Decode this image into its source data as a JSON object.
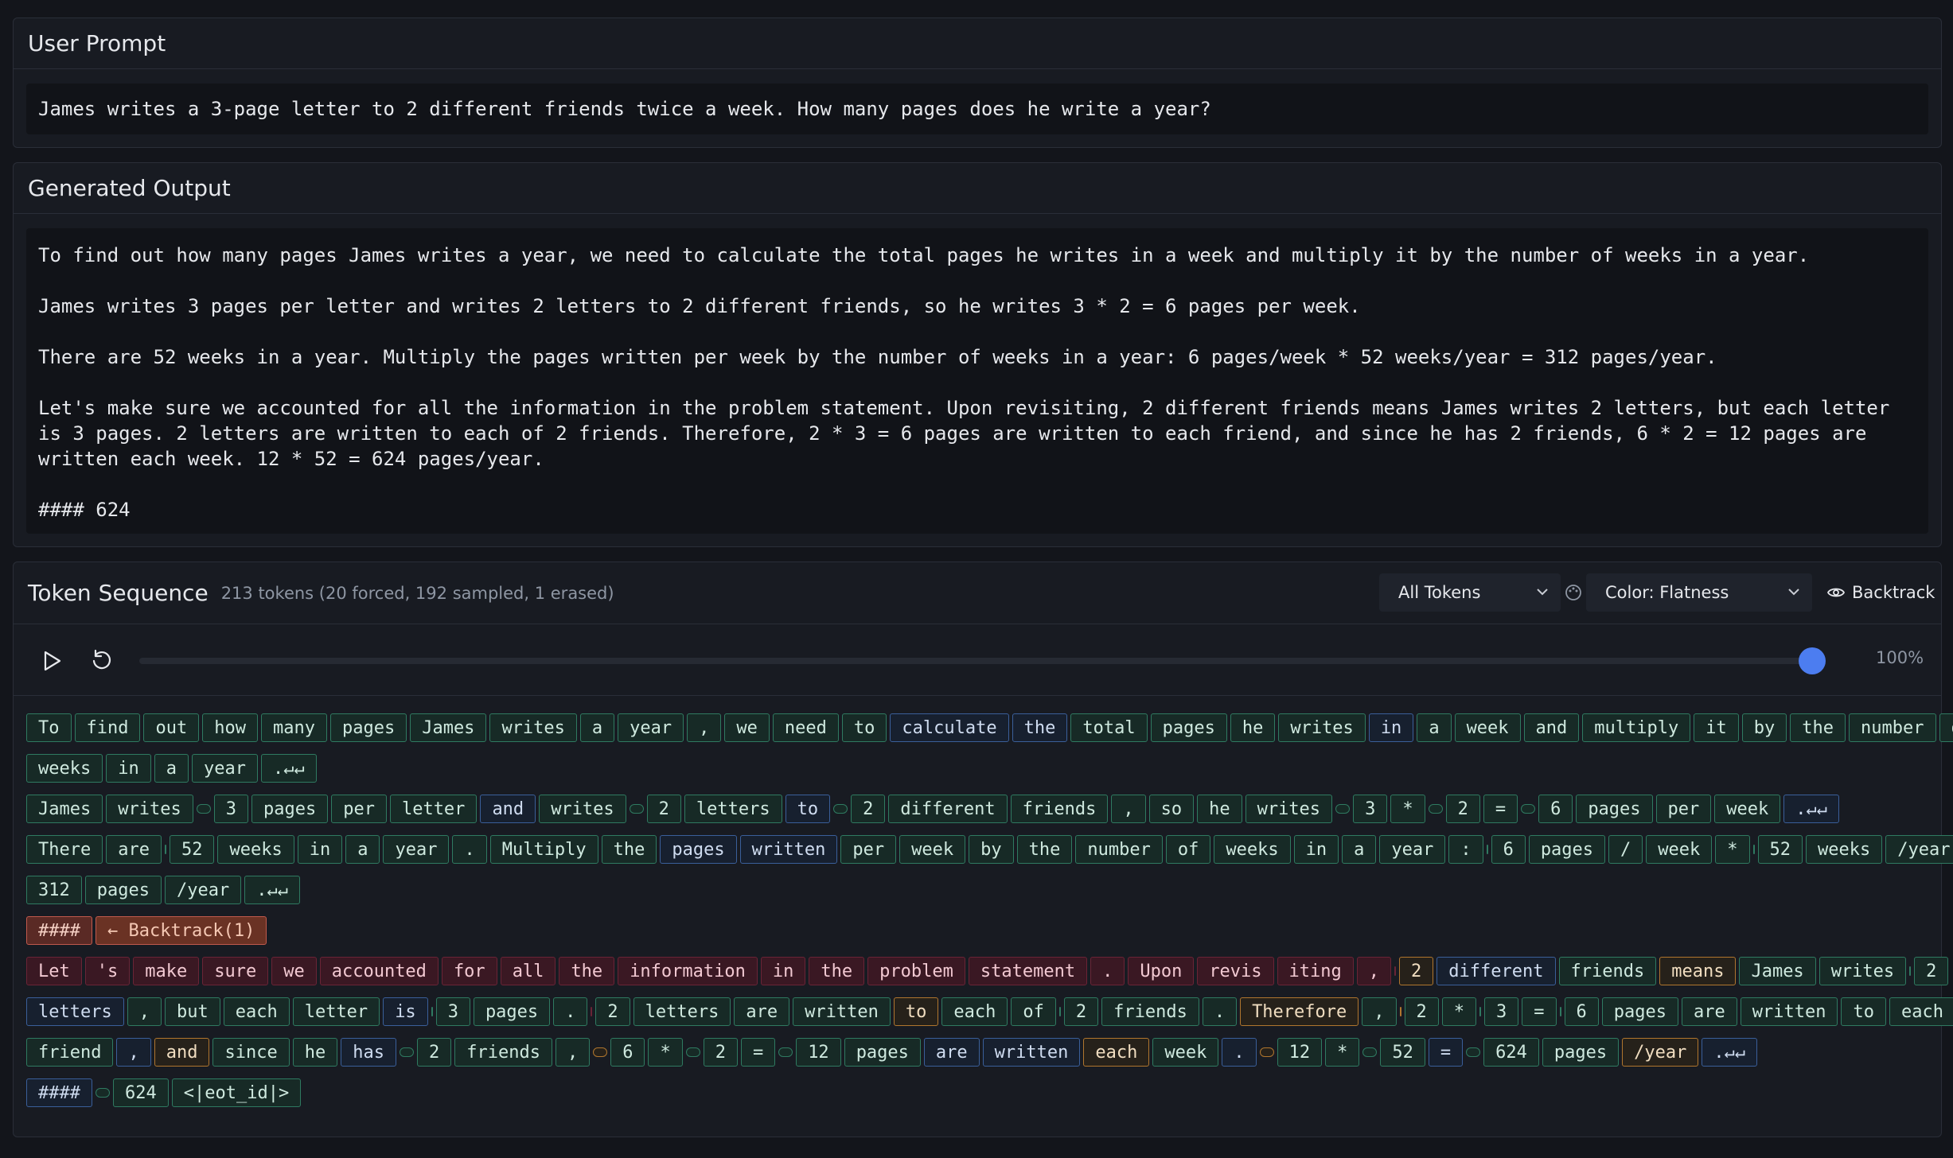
{
  "user_prompt": {
    "title": "User Prompt",
    "text": "James writes a 3-page letter to 2 different friends twice a week.  How many pages does he write a year?"
  },
  "generated_output": {
    "title": "Generated Output",
    "text": "To find out how many pages James writes a year, we need to calculate the total pages he writes in a week and multiply it by the number of weeks in a year.\n\nJames writes 3 pages per letter and writes 2 letters to 2 different friends, so he writes 3 * 2 = 6 pages per week.\n\nThere are 52 weeks in a year. Multiply the pages written per week by the number of weeks in a year: 6 pages/week * 52 weeks/year = 312 pages/year.\n\nLet's make sure we accounted for all the information in the problem statement. Upon revisiting, 2 different friends means James writes 2 letters, but each letter is 3 pages. 2 letters are written to each of 2 friends. Therefore, 2 * 3 = 6 pages are written to each friend, and since he has 2 friends, 6 * 2 = 12 pages are written each week. 12 * 52 = 624 pages/year.\n\n#### 624"
  },
  "token_sequence": {
    "title": "Token Sequence",
    "summary": "213 tokens (20 forced, 192 sampled, 1 erased)",
    "filter_label": "All Tokens",
    "color_label": "Color: Flatness",
    "backtrack_label": "Backtrack",
    "progress_percent": 100,
    "progress_label": "100%",
    "colors": {
      "green": "#2f7a61",
      "blue": "#3a5f9a",
      "orange": "#b0762e",
      "red": "#6a2436",
      "accent": "#4c7df0"
    },
    "lines": [
      [
        [
          "To",
          "g"
        ],
        [
          "find",
          "g"
        ],
        [
          "out",
          "g"
        ],
        [
          "how",
          "g"
        ],
        [
          "many",
          "g"
        ],
        [
          "pages",
          "g"
        ],
        [
          "James",
          "g"
        ],
        [
          "writes",
          "g"
        ],
        [
          "a",
          "g"
        ],
        [
          "year",
          "g"
        ],
        [
          ",",
          "g"
        ],
        [
          "we",
          "g"
        ],
        [
          "need",
          "g"
        ],
        [
          "to",
          "g"
        ],
        [
          "calculate",
          "b"
        ],
        [
          "the",
          "b"
        ],
        [
          "total",
          "g"
        ],
        [
          "pages",
          "g"
        ],
        [
          "he",
          "g"
        ],
        [
          "writes",
          "g"
        ],
        [
          "in",
          "b"
        ],
        [
          "a",
          "g"
        ],
        [
          "week",
          "g"
        ],
        [
          "and",
          "g"
        ],
        [
          "multiply",
          "g"
        ],
        [
          "it",
          "g"
        ],
        [
          "by",
          "g"
        ],
        [
          "the",
          "g"
        ],
        [
          "number",
          "g"
        ],
        [
          "of",
          "g"
        ]
      ],
      [
        [
          "weeks",
          "g"
        ],
        [
          "in",
          "g"
        ],
        [
          "a",
          "g"
        ],
        [
          "year",
          "g"
        ],
        [
          ".↵↵",
          "g"
        ]
      ],
      [
        [
          "James",
          "g"
        ],
        [
          "writes",
          "g"
        ],
        [
          "",
          "s"
        ],
        [
          "3",
          "g"
        ],
        [
          "pages",
          "g"
        ],
        [
          "per",
          "g"
        ],
        [
          "letter",
          "g"
        ],
        [
          "and",
          "b"
        ],
        [
          "writes",
          "g"
        ],
        [
          "",
          "s"
        ],
        [
          "2",
          "g"
        ],
        [
          "letters",
          "g"
        ],
        [
          "to",
          "b"
        ],
        [
          "",
          "s"
        ],
        [
          "2",
          "g"
        ],
        [
          "different",
          "g"
        ],
        [
          "friends",
          "g"
        ],
        [
          ",",
          "g"
        ],
        [
          "so",
          "g"
        ],
        [
          "he",
          "g"
        ],
        [
          "writes",
          "g"
        ],
        [
          "",
          "s"
        ],
        [
          "3",
          "g"
        ],
        [
          "*",
          "g"
        ],
        [
          "",
          "s"
        ],
        [
          "2",
          "g"
        ],
        [
          "=",
          "g"
        ],
        [
          "",
          "s"
        ],
        [
          "6",
          "g"
        ],
        [
          "pages",
          "g"
        ],
        [
          "per",
          "g"
        ],
        [
          "week",
          "g"
        ],
        [
          ".↵↵",
          "b"
        ]
      ],
      [
        [
          "There",
          "g"
        ],
        [
          "are",
          "g"
        ],
        [
          "",
          "s"
        ],
        [
          "52",
          "g"
        ],
        [
          "weeks",
          "g"
        ],
        [
          "in",
          "g"
        ],
        [
          "a",
          "g"
        ],
        [
          "year",
          "g"
        ],
        [
          ".",
          "g"
        ],
        [
          "Multiply",
          "g"
        ],
        [
          "the",
          "g"
        ],
        [
          "pages",
          "b"
        ],
        [
          "written",
          "b"
        ],
        [
          "per",
          "g"
        ],
        [
          "week",
          "g"
        ],
        [
          "by",
          "g"
        ],
        [
          "the",
          "g"
        ],
        [
          "number",
          "g"
        ],
        [
          "of",
          "g"
        ],
        [
          "weeks",
          "g"
        ],
        [
          "in",
          "g"
        ],
        [
          "a",
          "g"
        ],
        [
          "year",
          "g"
        ],
        [
          ":",
          "g"
        ],
        [
          "",
          "s"
        ],
        [
          "6",
          "g"
        ],
        [
          "pages",
          "g"
        ],
        [
          "/",
          "g"
        ],
        [
          "week",
          "g"
        ],
        [
          "*",
          "g"
        ],
        [
          "",
          "s"
        ],
        [
          "52",
          "g"
        ],
        [
          "weeks",
          "g"
        ],
        [
          "/year",
          "g"
        ],
        [
          "=",
          "g"
        ],
        [
          "",
          "s"
        ]
      ],
      [
        [
          "312",
          "g"
        ],
        [
          "pages",
          "g"
        ],
        [
          "/year",
          "g"
        ],
        [
          ".↵↵",
          "g"
        ]
      ],
      [
        [
          "####",
          "rr"
        ],
        [
          "← Backtrack(1)",
          "bk"
        ]
      ],
      [
        [
          "Let",
          "r"
        ],
        [
          "'s",
          "r"
        ],
        [
          "make",
          "r"
        ],
        [
          "sure",
          "r"
        ],
        [
          "we",
          "r"
        ],
        [
          "accounted",
          "r"
        ],
        [
          "for",
          "r"
        ],
        [
          "all",
          "r"
        ],
        [
          "the",
          "r"
        ],
        [
          "information",
          "r"
        ],
        [
          "in",
          "r"
        ],
        [
          "the",
          "r"
        ],
        [
          "problem",
          "r"
        ],
        [
          "statement",
          "r"
        ],
        [
          ".",
          "r"
        ],
        [
          "Upon",
          "r"
        ],
        [
          "revis",
          "r"
        ],
        [
          "iting",
          "r"
        ],
        [
          ",",
          "r"
        ],
        [
          "",
          "sr"
        ],
        [
          "2",
          "o"
        ],
        [
          "different",
          "b"
        ],
        [
          "friends",
          "g"
        ],
        [
          "means",
          "o"
        ],
        [
          "James",
          "g"
        ],
        [
          "writes",
          "g"
        ],
        [
          "",
          "s"
        ],
        [
          "2",
          "g"
        ]
      ],
      [
        [
          "letters",
          "b"
        ],
        [
          ",",
          "g"
        ],
        [
          "but",
          "g"
        ],
        [
          "each",
          "g"
        ],
        [
          "letter",
          "g"
        ],
        [
          "is",
          "b"
        ],
        [
          "",
          "s"
        ],
        [
          "3",
          "g"
        ],
        [
          "pages",
          "g"
        ],
        [
          ".",
          "g"
        ],
        [
          "",
          "sr"
        ],
        [
          "2",
          "g"
        ],
        [
          "letters",
          "g"
        ],
        [
          "are",
          "g"
        ],
        [
          "written",
          "g"
        ],
        [
          "to",
          "o"
        ],
        [
          "each",
          "g"
        ],
        [
          "of",
          "g"
        ],
        [
          "",
          "s"
        ],
        [
          "2",
          "g"
        ],
        [
          "friends",
          "g"
        ],
        [
          ".",
          "g"
        ],
        [
          "Therefore",
          "o"
        ],
        [
          ",",
          "g"
        ],
        [
          "",
          "so"
        ],
        [
          "2",
          "g"
        ],
        [
          "*",
          "g"
        ],
        [
          "",
          "s"
        ],
        [
          "3",
          "g"
        ],
        [
          "=",
          "g"
        ],
        [
          "",
          "s"
        ],
        [
          "6",
          "g"
        ],
        [
          "pages",
          "g"
        ],
        [
          "are",
          "g"
        ],
        [
          "written",
          "g"
        ],
        [
          "to",
          "g"
        ],
        [
          "each",
          "g"
        ]
      ],
      [
        [
          "friend",
          "g"
        ],
        [
          ",",
          "b"
        ],
        [
          "and",
          "o"
        ],
        [
          "since",
          "g"
        ],
        [
          "he",
          "g"
        ],
        [
          "has",
          "b"
        ],
        [
          "",
          "s"
        ],
        [
          "2",
          "g"
        ],
        [
          "friends",
          "g"
        ],
        [
          ",",
          "g"
        ],
        [
          "",
          "so"
        ],
        [
          "6",
          "g"
        ],
        [
          "*",
          "g"
        ],
        [
          "",
          "s"
        ],
        [
          "2",
          "g"
        ],
        [
          "=",
          "g"
        ],
        [
          "",
          "s"
        ],
        [
          "12",
          "g"
        ],
        [
          "pages",
          "g"
        ],
        [
          "are",
          "b"
        ],
        [
          "written",
          "b"
        ],
        [
          "each",
          "o"
        ],
        [
          "week",
          "g"
        ],
        [
          ".",
          "b"
        ],
        [
          "",
          "so"
        ],
        [
          "12",
          "g"
        ],
        [
          "*",
          "g"
        ],
        [
          "",
          "s"
        ],
        [
          "52",
          "g"
        ],
        [
          "=",
          "b"
        ],
        [
          "",
          "s"
        ],
        [
          "624",
          "g"
        ],
        [
          "pages",
          "g"
        ],
        [
          "/year",
          "o"
        ],
        [
          ".↵↵",
          "b"
        ]
      ],
      [
        [
          "####",
          "b"
        ],
        [
          "",
          "s"
        ],
        [
          "624",
          "g"
        ],
        [
          "<|eot_id|>",
          "g"
        ]
      ]
    ]
  }
}
